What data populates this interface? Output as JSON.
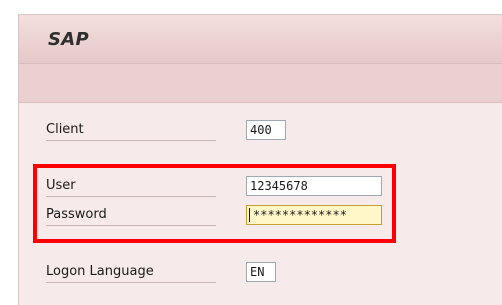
{
  "app": {
    "title": "SAP"
  },
  "form": {
    "client": {
      "label": "Client",
      "value": "400"
    },
    "user": {
      "label": "User",
      "value": "12345678"
    },
    "password": {
      "label": "Password",
      "value": "*************"
    },
    "language": {
      "label": "Logon Language",
      "value": "EN"
    }
  },
  "colors": {
    "panel_bg": "#f6eaea",
    "header_bg": "#ecd2d2",
    "highlight": "#ff0000",
    "focused_input_bg": "#fff7c8"
  }
}
